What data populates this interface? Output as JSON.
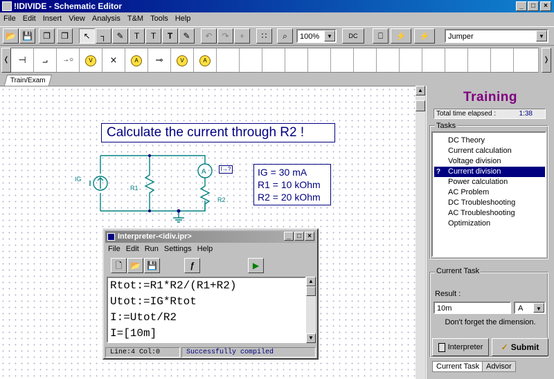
{
  "window": {
    "title": "!IDIVIDE - Schematic Editor",
    "min": "_",
    "max": "□",
    "close": "×"
  },
  "menu": [
    "File",
    "Edit",
    "Insert",
    "View",
    "Analysis",
    "T&M",
    "Tools",
    "Help"
  ],
  "toolbar": {
    "zoom": "100%",
    "component": "Jumper",
    "buttons": {
      "open": "📂",
      "save": "💾",
      "copy": "❐",
      "pointer": "↖",
      "wire": "┐",
      "pen": "✎",
      "text": "T",
      "undo": "↶",
      "redo": "↷",
      "cross": "+",
      "grid": "∷",
      "zoom": "⌕",
      "dc": "DC",
      "meter": "⎕",
      "plug": "⚡"
    }
  },
  "palette": [
    "⊣",
    "⨼",
    "→○",
    "V",
    "⨯",
    "A",
    "⊸",
    "V",
    "A"
  ],
  "tab_train": "Train/Exam",
  "canvas": {
    "question": "Calculate the current through R2 !",
    "values": [
      "IG = 30 mA",
      "R1 = 10 kOhm",
      "R2 = 20 kOhm"
    ],
    "labels": {
      "ig": "IG",
      "r1": "R1",
      "r2": "R2",
      "ammeter": "A",
      "meter_tag": "I→?"
    }
  },
  "interpreter": {
    "title": "Interpreter-<idiv.ipr>",
    "menu": [
      "File",
      "Edit",
      "Run",
      "Settings",
      "Help"
    ],
    "code": [
      "Rtot:=R1*R2/(R1+R2)",
      "Utot:=IG*Rtot",
      "I:=Utot/R2",
      "I=[10m]"
    ],
    "status_pos": "Line:4 Col:0",
    "status_msg": "Successfully compiled"
  },
  "training": {
    "title": "Training",
    "elapsed_label": "Total time elapsed :",
    "elapsed_value": "1:38",
    "tasks_label": "Tasks",
    "tasks": [
      "DC Theory",
      "Current calculation",
      "Voltage division",
      "Current division",
      "Power calculation",
      "AC Problem",
      "DC Troubleshooting",
      "AC Troubleshooting",
      "Optimization"
    ],
    "selected_task": "Current division",
    "current_task_label": "Current Task",
    "result_label": "Result :",
    "result_value": "10m",
    "unit": "A",
    "hint": "Don't forget the dimension.",
    "interpreter_button": "Interpreter",
    "submit_button": "Submit",
    "tab_current": "Current Task",
    "tab_advisor": "Advisor"
  },
  "colors": {
    "title_bar": "#000080",
    "selection": "#000080",
    "training_title": "#800080",
    "question_text": "#000080",
    "circuit": "#008080"
  }
}
